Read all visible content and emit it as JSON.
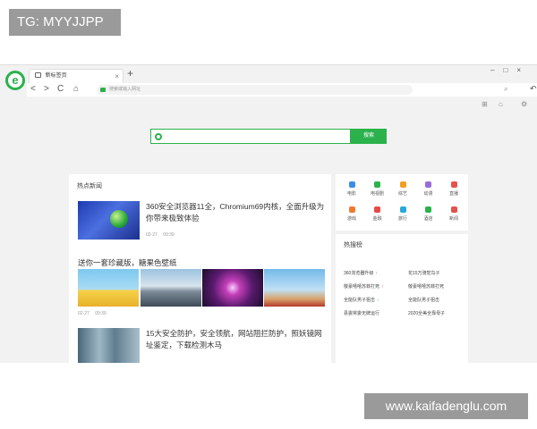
{
  "watermarks": {
    "top": "TG: MYYJJPP",
    "bottom": "www.kaifadenglu.com"
  },
  "browser": {
    "logo_glyph": "e",
    "tab": {
      "title": "新标签页",
      "close": "×"
    },
    "new_tab": "+",
    "window_controls": {
      "minimize": "–",
      "maximize": "□",
      "close": "×"
    },
    "nav": {
      "back": "<",
      "forward": ">",
      "reload": "C",
      "home": "⌂"
    },
    "address": {
      "placeholder": "搜索或输入网址"
    },
    "address_search_icon": "⌕",
    "right": {
      "undo": "↶",
      "menu": "≡"
    }
  },
  "page": {
    "tools": [
      "⊞",
      "⌂",
      "⚙"
    ],
    "search": {
      "button": "搜索"
    },
    "news": {
      "section_title": "热点新闻",
      "item1": {
        "title": "360安全浏览器11全，Chromium69内核，全面升级为你带来极致体验",
        "date": "02-27",
        "time": "09:39"
      },
      "item2": {
        "title": "送你一套珍藏版，糖果色壁纸",
        "date": "02-27",
        "time": "09:39"
      },
      "item3": {
        "title": "15大安全防护，安全领航，网站阻拦防护，照妖镜网址鉴定，下载检测木马"
      }
    },
    "apps": [
      {
        "label": "电影",
        "color": "#3a8ee6"
      },
      {
        "label": "电视剧",
        "color": "#2bb24c"
      },
      {
        "label": "综艺",
        "color": "#f0a020"
      },
      {
        "label": "动漫",
        "color": "#9b6bd9"
      },
      {
        "label": "直播",
        "color": "#e8504a"
      },
      {
        "label": "游戏",
        "color": "#f07a30"
      },
      {
        "label": "金融",
        "color": "#e84a4a"
      },
      {
        "label": "旅行",
        "color": "#28a8d8"
      },
      {
        "label": "酒店",
        "color": "#2bb24c"
      },
      {
        "label": "新闻",
        "color": "#e8504a"
      }
    ],
    "hot": {
      "title": "热搜榜",
      "items": [
        {
          "text": "360浏览器升级",
          "mark": "up"
        },
        {
          "text": "花15万骑鸵鸟子",
          "mark": ""
        },
        {
          "text": "敬豪嘻嘻苏菲打死",
          "mark": "up"
        },
        {
          "text": "敬豪嘻嘻苏菲打死",
          "mark": ""
        },
        {
          "text": "全能队男子狙击",
          "mark": "dn"
        },
        {
          "text": "全能队男子狙击",
          "mark": ""
        },
        {
          "text": "县委常委无牌运行",
          "mark": ""
        },
        {
          "text": "2020全美全靠母子",
          "mark": ""
        }
      ]
    }
  }
}
